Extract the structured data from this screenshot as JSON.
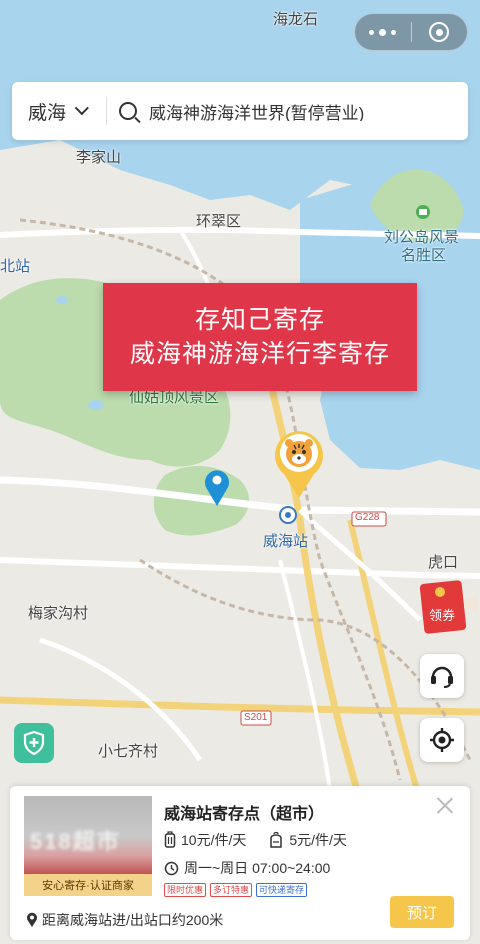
{
  "header": {
    "city": "威海",
    "search_value": "威海神游海洋世界(暂停营业)"
  },
  "map": {
    "labels": {
      "hailongshi": "海龙石",
      "lijiashan": "李家山",
      "huancui": "环翠区",
      "liugongdao": "刘公岛风景",
      "liugongdao2": "名胜区",
      "bei_zhan": "北站",
      "xianguding": "仙姑顶风景区",
      "weihai_station": "威海站",
      "road_g228": "G228",
      "hukou": "虎口",
      "meijiagou": "梅家沟村",
      "road_s201": "S201",
      "xiaoqiqi": "小七齐村"
    }
  },
  "banner": {
    "line1": "存知己寄存",
    "line2": "威海神游海洋行李寄存"
  },
  "coupon": {
    "label": "领券"
  },
  "card": {
    "title": "威海站寄存点（超市）",
    "thumb_text": "518超市",
    "cert": "安心寄存·认证商家",
    "price_small": "10元/件/天",
    "price_large": "5元/件/天",
    "hours": "周一~周日 07:00~24:00",
    "tags": [
      "限时优惠",
      "多订特惠",
      "可快递寄存"
    ],
    "distance": "距离威海站进/出站口约200米",
    "book_label": "预订"
  },
  "colors": {
    "accent_red": "#e0364a",
    "accent_yellow": "#f6c64a",
    "water": "#a9d4ee",
    "green": "#bcdcae"
  }
}
